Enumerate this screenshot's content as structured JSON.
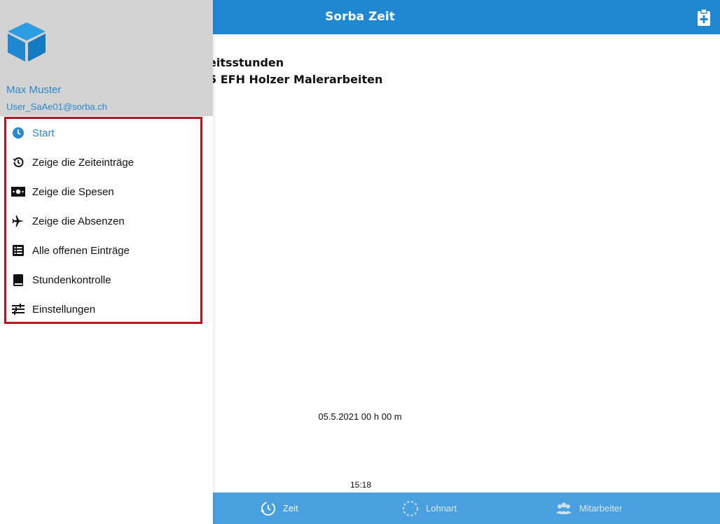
{
  "header": {
    "title": "Sorba Zeit",
    "action_icon": "clipboard-plus-icon"
  },
  "main": {
    "line1": "eitsstunden",
    "line2": "5 EFH Holzer Malerarbeiten",
    "date_summary": "05.5.2021 00 h 00 m",
    "time_stamp": "15:18"
  },
  "drawer": {
    "user_name": "Max Muster",
    "user_email": "User_SaAe01@sorba.ch",
    "menu": [
      {
        "label": "Start",
        "icon": "clock-icon",
        "active": true
      },
      {
        "label": "Zeige die Zeiteinträge",
        "icon": "history-icon"
      },
      {
        "label": "Zeige die Spesen",
        "icon": "money-icon"
      },
      {
        "label": "Zeige die Absenzen",
        "icon": "airplane-icon"
      },
      {
        "label": "Alle offenen Einträge",
        "icon": "list-icon"
      },
      {
        "label": "Stundenkontrolle",
        "icon": "book-icon"
      },
      {
        "label": "Einstellungen",
        "icon": "sliders-icon"
      }
    ]
  },
  "tabbar": {
    "tabs": [
      {
        "label": "Zeit",
        "icon": "clock-hand-icon"
      },
      {
        "label": "Lohnart",
        "icon": "spinner-icon"
      },
      {
        "label": "Mitarbeiter",
        "icon": "users-icon"
      }
    ]
  },
  "colors": {
    "header": "#2088d0",
    "tabbar": "#4aa0de",
    "accent": "#2a88cc",
    "highlight_border": "#b5161e",
    "drawer_header": "#d3d3d3"
  }
}
